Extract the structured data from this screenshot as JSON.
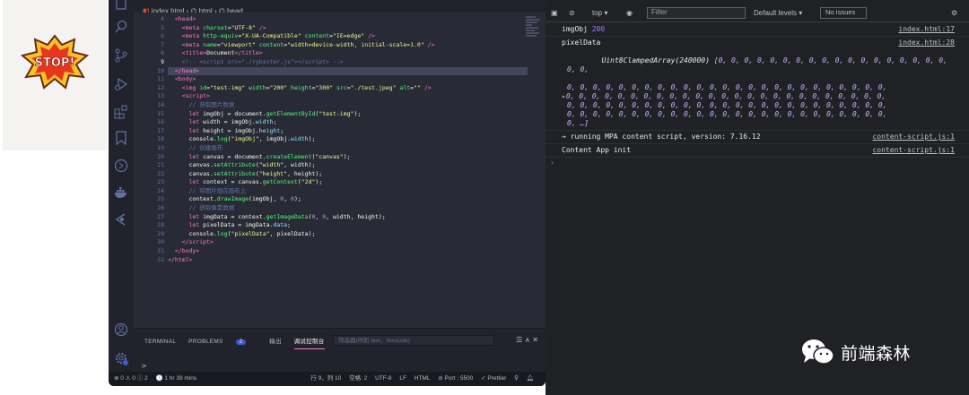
{
  "image_preview": {
    "sticker_text": "STOP!"
  },
  "breadcrumb": {
    "file": "index.html",
    "item1": "html",
    "item2": "head"
  },
  "editor": {
    "lines": [
      "4",
      "5",
      "6",
      "7",
      "8",
      "9",
      "10",
      "11",
      "12",
      "13",
      "14",
      "15",
      "16",
      "17",
      "18",
      "19",
      "20",
      "21",
      "22",
      "23",
      "24",
      "25",
      "26",
      "27",
      "28",
      "29",
      "30",
      "31",
      "32"
    ]
  },
  "panel": {
    "tab_terminal": "TERMINAL",
    "tab_problems": "PROBLEMS",
    "problems_count": "2",
    "tab_output": "输出",
    "tab_debug_console": "调试控制台",
    "filter_placeholder": "筛选器(例如 text、!exclude)",
    "prompt": ">"
  },
  "status": {
    "problems": "⊗ 0 ⚠ 0 ⓘ 2",
    "time": "🕓 1 hr 39 mins",
    "cursor": "行 9，列 10",
    "spaces": "空格: 2",
    "encoding": "UTF-8",
    "eol": "LF",
    "language": "HTML",
    "port": "⊘ Port : 5500",
    "prettier": "✓ Prettier"
  },
  "devtools": {
    "context": "top",
    "filter_placeholder": "Filter",
    "levels": "Default levels",
    "issues": "No Issues",
    "logs": [
      {
        "label": "imgObj",
        "value": "200",
        "source": "index.html:17"
      },
      {
        "label": "pixelData",
        "source": "index.html:28",
        "array_head": "Uint8ClampedArray(240000)"
      },
      {
        "label": "→ running MPA content script, version: 7.16.12",
        "source": "content-script.js:1"
      },
      {
        "label": "Content App init",
        "source": "content-script.js:1"
      }
    ],
    "array_line1": "[0, 0, 0, 0, 0, 0, 0, 0, 0, 0, 0, 0, 0, 0, 0, 0, 0, 0, 0, 0,",
    "array_line2": "0, 0, 0, 0, 0, 0, 0, 0, 0, 0, 0, 0, 0, 0, 0, 0, 0, 0, 0, 0, 0, 0, 0, 0, 0,",
    "array_line3": "0, 0, 0, 0, 0, 0, 0, 0, 0, 0, 0, 0, 0, 0, 0, 0, 0, 0, 0, 0, 0, 0, 0, 0, 0,",
    "array_line4": "0, 0, 0, 0, 0, 0, 0, 0, 0, 0, 0, 0, 0, 0, 0, 0, 0, 0, 0, 0, 0, 0, 0, 0, 0,",
    "array_line5": "0, 0, 0, 0, 0, 0, 0, 0, 0, 0, 0, 0, 0, 0, 0, 0, 0, 0, 0, 0, 0, 0, 0, 0, 0,",
    "array_line6": "0, …]"
  },
  "watermark": {
    "text": "前端森林"
  }
}
